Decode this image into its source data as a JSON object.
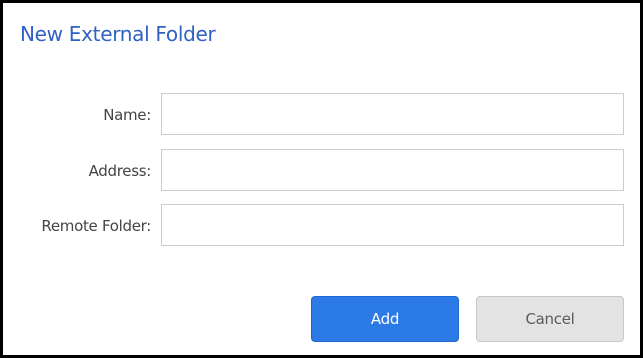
{
  "dialog": {
    "title": "New External Folder",
    "fields": {
      "name": {
        "label": "Name:",
        "value": "",
        "placeholder": ""
      },
      "address": {
        "label": "Address:",
        "value": "",
        "placeholder": ""
      },
      "remote_folder": {
        "label": "Remote Folder:",
        "value": "",
        "placeholder": ""
      }
    },
    "buttons": {
      "add_label": "Add",
      "cancel_label": "Cancel"
    }
  },
  "colors": {
    "title": "#2f62c4",
    "primary_button": "#2b7ae6",
    "secondary_button": "#e3e3e3",
    "border": "#000000"
  }
}
